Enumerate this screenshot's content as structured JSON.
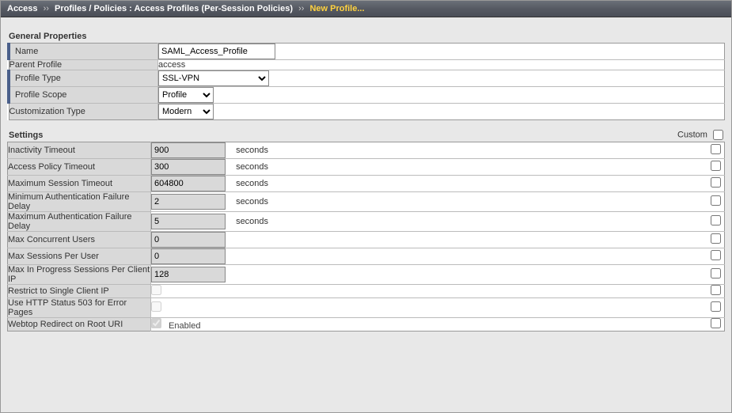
{
  "breadcrumb": {
    "root": "Access",
    "path": "Profiles / Policies : Access Profiles (Per-Session Policies)",
    "current": "New Profile...",
    "sep": "››"
  },
  "sections": {
    "general_title": "General Properties",
    "settings_title": "Settings",
    "custom_label": "Custom"
  },
  "general": {
    "name_label": "Name",
    "name_value": "SAML_Access_Profile",
    "parent_label": "Parent Profile",
    "parent_value": "access",
    "type_label": "Profile Type",
    "type_value": "SSL-VPN",
    "scope_label": "Profile Scope",
    "scope_value": "Profile",
    "custtype_label": "Customization Type",
    "custtype_value": "Modern"
  },
  "settings": {
    "inact_label": "Inactivity Timeout",
    "inact_value": "900",
    "inact_unit": "seconds",
    "apolicy_label": "Access Policy Timeout",
    "apolicy_value": "300",
    "apolicy_unit": "seconds",
    "maxsess_label": "Maximum Session Timeout",
    "maxsess_value": "604800",
    "maxsess_unit": "seconds",
    "minauth_label": "Minimum Authentication Failure Delay",
    "minauth_value": "2",
    "minauth_unit": "seconds",
    "maxauth_label": "Maximum Authentication Failure Delay",
    "maxauth_value": "5",
    "maxauth_unit": "seconds",
    "maxconc_label": "Max Concurrent Users",
    "maxconc_value": "0",
    "maxspu_label": "Max Sessions Per User",
    "maxspu_value": "0",
    "maxip_label": "Max In Progress Sessions Per Client IP",
    "maxip_value": "128",
    "restrict_label": "Restrict to Single Client IP",
    "http503_label": "Use HTTP Status 503 for Error Pages",
    "webtop_label": "Webtop Redirect on Root URI",
    "enabled_text": "Enabled"
  }
}
